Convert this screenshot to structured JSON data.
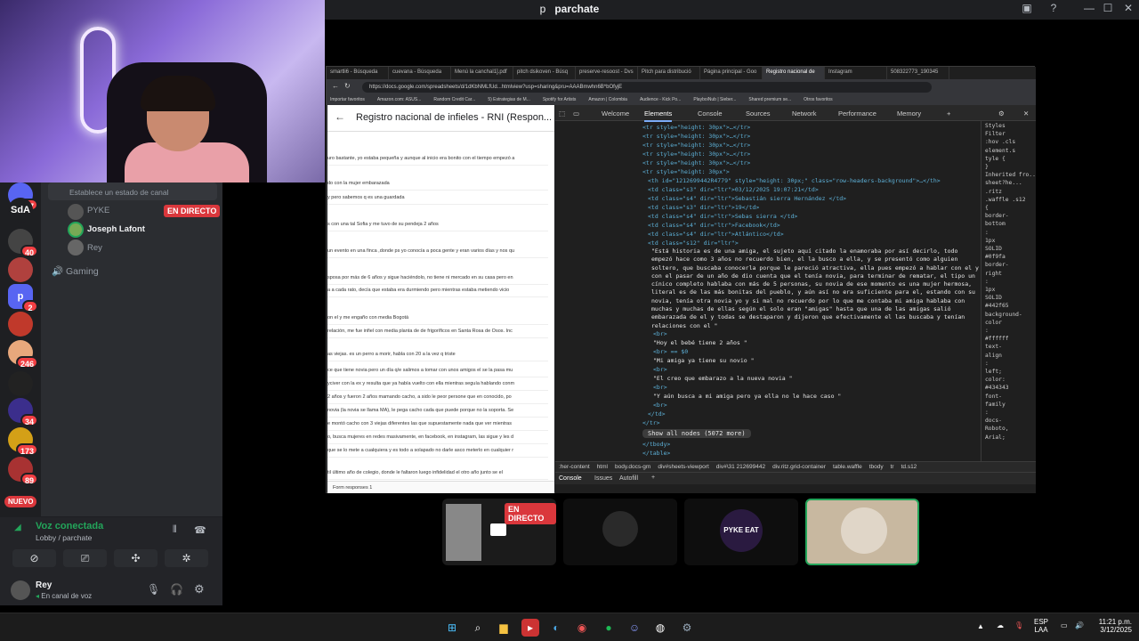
{
  "window": {
    "title_prefix": "p",
    "title": "parchate"
  },
  "servers": [
    {
      "label": "",
      "badge": "377"
    },
    {
      "label": "SdA",
      "badge": ""
    },
    {
      "label": "",
      "badge": "40"
    },
    {
      "label": "",
      "badge": ""
    },
    {
      "label": "p",
      "badge": "2"
    },
    {
      "label": "",
      "badge": ""
    },
    {
      "label": "",
      "badge": "246"
    },
    {
      "label": "",
      "badge": ""
    },
    {
      "label": "",
      "badge": "34"
    },
    {
      "label": "",
      "badge": "173"
    },
    {
      "label": "",
      "badge": "89"
    },
    {
      "label": "",
      "badge": "NUEVO"
    }
  ],
  "channel": {
    "lobby_title": "Lobby",
    "status_placeholder": "Establece un estado de canal",
    "members": [
      {
        "name": "PYKE",
        "live": "EN DIRECTO"
      },
      {
        "name": "Joseph Lafont",
        "live": ""
      },
      {
        "name": "Rey",
        "live": ""
      }
    ],
    "gaming": "Gaming"
  },
  "voice": {
    "status": "Voz conectada",
    "location": "Lobby / parchate"
  },
  "user": {
    "name": "Rey",
    "status": "En canal de voz"
  },
  "browser": {
    "tabs": [
      "smartli6 - Búsqueda",
      "cuevana - Búsqueda",
      "Menú la canchal1].pdf",
      "pitch dsikoven - Búsq",
      "preserve-resoost - Dvs",
      "Pitch para distribució",
      "Página principal - Goo",
      "Registro nacional de",
      "Instagram",
      "508322773_190345"
    ],
    "active_tab": 7,
    "url": "https://docs.google.com/spreadsheets/d/1dKbNMLfUd...htmlview?usp=sharing&pru=AAABmwhn6B*bOfyjE",
    "bookmarks": [
      "Importar favoritos",
      "Amazon.com: ASUS...",
      "Random Credit Car...",
      "5) Estrategias de M...",
      "Spotify for Artists",
      "Amazon | Colombia",
      "Audience - Kick Po...",
      "PlayboiNub | Sieber...",
      "Shared premium se...",
      "Otros favoritos"
    ]
  },
  "sheet": {
    "title": "Registro nacional de infieles - RNI (Respon...",
    "rows": [
      "uro bastante, yo estaba pequeña y aunque al inicio era bonito con el tiempo empezó a",
      "do con la mujer embarazada",
      "y pero sabemos q es una guardada",
      "s con una tal Sofia y me tuvo de su pendeja 2 años",
      "un evento en una finca ,donde ps yo conocía a poca gente y eran varios días y nos qu",
      "sposa por más de 6 años y sigue haciéndolo, no tiene ni mercado en su casa pero en",
      "a a cada rato, decía que estaba era durmiendo pero mientras estaba metiendo vicio",
      "on el y me engaño con media Bogotá",
      "relación, me fue infiel con media planta de de frigoríficos en Santa Rosa de Osos. Inc",
      "as viejas. es un perro a morir, habla con 20 a la vez q triste",
      "ce que tiene novia pero un día q/e salimos a tomar con unos amigos el se la pasa mu",
      "yciver con la ex y resulta que ya había vuelto con ella mientras seguía hablando conm",
      "2 años y fueron 2 años mamando cacho, a sido le peor persone que en conocido, po",
      "novia (la novia se llama MA), le pega cacho cada que puede porque no la soporta. Se",
      "e montó cacho con 3 viejas diferentes las que supuestamente nada que ver mientras",
      "o, busca mujeres en redes masivamente, en facebook, en instagram, las sigue y les d",
      "que se lo mete a cualquiera y es todo a solapado no darle asco meterlo en cualquier r",
      "til último año de colegio, donde le faltaron luego infidelidad el otro año junto se el"
    ],
    "footer": "Form responses 1"
  },
  "devtools": {
    "tabs": [
      "Welcome",
      "Elements",
      "Console",
      "Sources",
      "Network",
      "Performance",
      "Memory"
    ],
    "active": "Elements",
    "lines": [
      {
        "indent": 0,
        "text": "<tr style=\"height: 30px\">…</tr>"
      },
      {
        "indent": 0,
        "text": "<tr style=\"height: 30px\">…</tr>"
      },
      {
        "indent": 0,
        "text": "<tr style=\"height: 30px\">…</tr>"
      },
      {
        "indent": 0,
        "text": "<tr style=\"height: 30px\">…</tr>"
      },
      {
        "indent": 0,
        "text": "<tr style=\"height: 30px\">…</tr>"
      },
      {
        "indent": 0,
        "text": "<tr style=\"height: 30px\">"
      },
      {
        "indent": 1,
        "text": "<th id=\"1212699442R4779\" style=\"height: 30px;\" class=\"row-headers-background\">…</th>"
      },
      {
        "indent": 1,
        "text": "<td class=\"s3\" dir=\"ltr\">03/12/2025 19:07:21</td>"
      },
      {
        "indent": 1,
        "text": "<td class=\"s4\" dir=\"ltr\">Sebastián sierra Hernández </td>"
      },
      {
        "indent": 1,
        "text": "<td class=\"s3\" dir=\"ltr\">19</td>"
      },
      {
        "indent": 1,
        "text": "<td class=\"s4\" dir=\"ltr\">Sebas sierra </td>"
      },
      {
        "indent": 1,
        "text": "<td class=\"s4\" dir=\"ltr\">Facebook</td>"
      },
      {
        "indent": 1,
        "text": "<td class=\"s4\" dir=\"ltr\">Atlántico</td>"
      },
      {
        "indent": 1,
        "text": "<td class=\"s12\" dir=\"ltr\">"
      }
    ],
    "paragraph": "\"Está historia es de una amiga, el sujeto aquí citado la enamoraba por así decirlo, todo empezó hace como 3 años no recuerdo bien, el la busco a ella, y se presentó como alguien soltero, que buscaba conocerla porque le pareció atractiva, ella pues empezó a hablar con el y con el pasar de un año de dio cuenta que el tenía novia, para terminar de rematar, el tipo un cínico completo hablaba con más de 5 personas, su novia de ese momento es una mujer hermosa, literal es de las más bonitas del pueblo, y aún así no era suficiente para el, estando con su novia, tenía otra novia yo y si mal no recuerdo por lo que me contaba mi amiga hablaba con muchas y muchas de ellas según el solo eran \"amigas\" hasta que una de las amigas salió embarazada de el y todas se destaparon y dijeron que efectivamente el las buscaba y tenían relaciones con el \"",
    "tail": [
      {
        "indent": 2,
        "text": "<br>"
      },
      {
        "indent": 2,
        "text": "\"Hoy el bebé tiene 2 años \""
      },
      {
        "indent": 2,
        "text": "<br> == $0"
      },
      {
        "indent": 2,
        "text": "\"Mi amiga ya tiene su novio \""
      },
      {
        "indent": 2,
        "text": "<br>"
      },
      {
        "indent": 2,
        "text": "\"El creo que embarazo a la nueva novia \""
      },
      {
        "indent": 2,
        "text": "<br>"
      },
      {
        "indent": 2,
        "text": "\"Y aún busca a mi amiga pero ya ella no le hace caso \""
      },
      {
        "indent": 2,
        "text": "<br>"
      },
      {
        "indent": 1,
        "text": "</td>"
      },
      {
        "indent": 0,
        "text": "</tr>"
      }
    ],
    "show_all": "Show all nodes (5072 more)",
    "tail2": [
      "</tbody>",
      "</table>"
    ],
    "crumbs": [
      ":her-content",
      "html",
      "body.docs-gm",
      "div#sheets-viewport",
      "div#\\31 212699442",
      "div.ritz.grid-container",
      "table.waffle",
      "tbody",
      "tr",
      "td.s12"
    ],
    "drawer": [
      "Console",
      "Issues",
      "Autofill"
    ],
    "styles": [
      "Styles",
      "Filter",
      ":hov .cls",
      "element.s",
      "tyle {",
      "}",
      "Inherited fro...",
      "sheet?he...",
      ".ritz",
      ".waffle .s12",
      "{",
      "border-",
      "bottom",
      ":",
      "1px",
      "SOLID",
      "#0f9fa",
      "border-",
      "right",
      ":",
      "1px",
      "SOLID",
      "#442f65",
      "background-",
      "color",
      ":",
      "#ffffff",
      "text-",
      "align",
      ":",
      "left;",
      "color:",
      "#434343",
      "font-",
      "family",
      ":",
      "docs-",
      "Roboto,",
      "Arial;"
    ]
  },
  "stage": {
    "live": "EN DIRECTO",
    "logo": "PYKE EAT"
  },
  "tray": {
    "lang1": "ESP",
    "lang2": "LAA",
    "time": "11:21 p.m.",
    "date": "3/12/2025"
  },
  "colors": {
    "discord_bg": "#2b2d31",
    "live_red": "#da373c",
    "voice_green": "#23a55a",
    "devtools_bg": "#1f1f1f"
  }
}
